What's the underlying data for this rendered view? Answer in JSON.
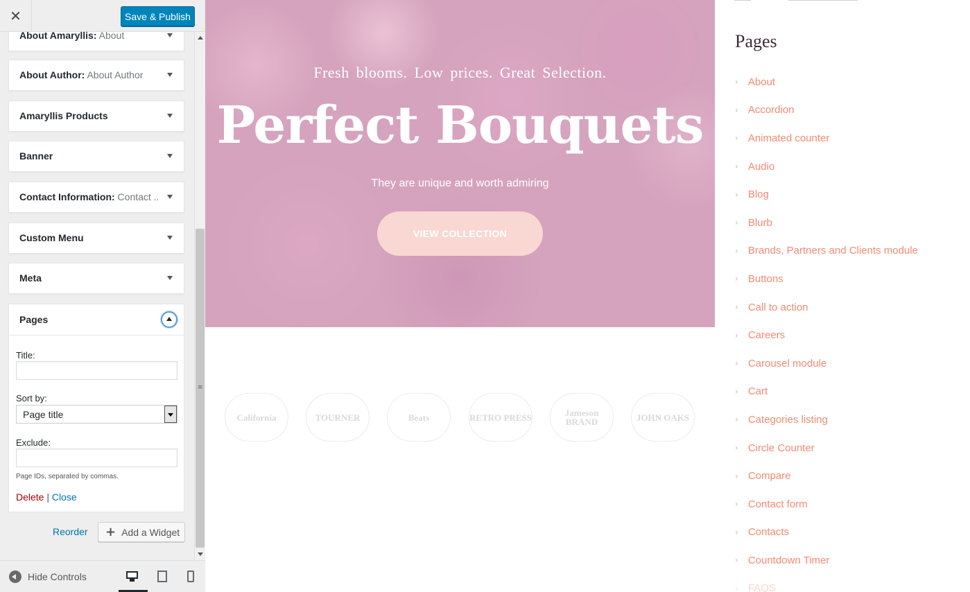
{
  "topbar": {
    "close_symbol": "✕",
    "publish_label": "Save & Publish"
  },
  "widgets": [
    {
      "title": "About Amaryllis:",
      "subtitle": " About"
    },
    {
      "title": "About Author:",
      "subtitle": " About Author"
    },
    {
      "title": "Amaryllis Products",
      "subtitle": ""
    },
    {
      "title": "Banner",
      "subtitle": ""
    },
    {
      "title": "Contact Information:",
      "subtitle": " Contact ..."
    },
    {
      "title": "Custom Menu",
      "subtitle": ""
    },
    {
      "title": "Meta",
      "subtitle": ""
    }
  ],
  "pages_widget": {
    "title": "Pages",
    "title_label": "Title:",
    "title_value": "",
    "sort_label": "Sort by:",
    "sort_value": "Page title",
    "exclude_label": "Exclude:",
    "exclude_value": "",
    "exclude_help": "Page IDs, separated by commas.",
    "delete_label": "Delete",
    "separator": "|",
    "close_label": "Close"
  },
  "sidebar_actions": {
    "reorder_label": "Reorder",
    "add_widget_label": "Add a Widget",
    "plus_symbol": "+"
  },
  "footer": {
    "hide_controls_label": "Hide Controls"
  },
  "hero": {
    "tagline": "Fresh blooms.  Low prices.  Great Selection.",
    "title": "Perfect Bouquets",
    "subtitle": "They are unique and worth admiring",
    "button_label": "VIEW COLLECTION"
  },
  "brands": [
    {
      "name": "California"
    },
    {
      "name": "TOURNER"
    },
    {
      "name": "Beats"
    },
    {
      "name": "RETRO PRESS"
    },
    {
      "name": "Jameson BRAND"
    },
    {
      "name": "JOHN OAKS"
    }
  ],
  "right_col": {
    "heading": "Pages",
    "chevron": "›",
    "pages": [
      "About",
      "Accordion",
      "Animated counter",
      "Audio",
      "Blog",
      "Blurb",
      "Brands, Partners and Clients module",
      "Buttons",
      "Call to action",
      "Careers",
      "Carousel module",
      "Cart",
      "Categories listing",
      "Circle Counter",
      "Compare",
      "Contact form",
      "Contacts",
      "Countdown Timer",
      "FAQS"
    ]
  },
  "colors": {
    "accent": "#0085ba",
    "link": "#f58a73",
    "delete": "#aa0000"
  }
}
